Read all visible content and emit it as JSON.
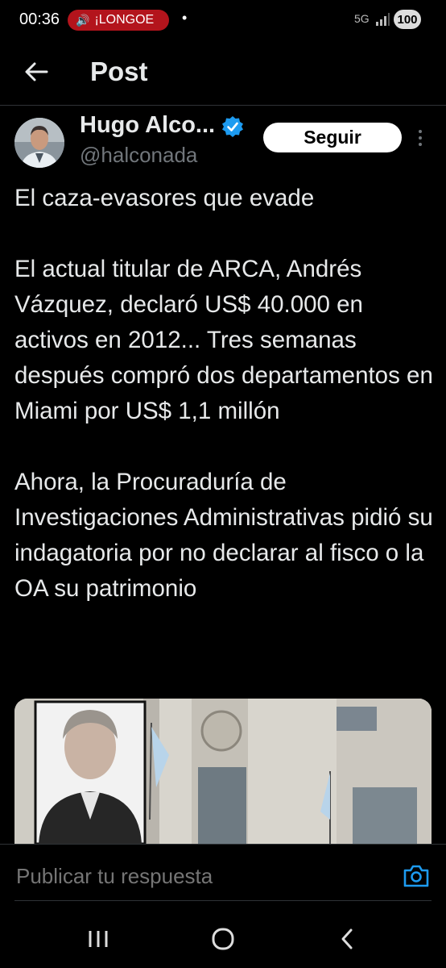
{
  "status_bar": {
    "time": "00:36",
    "notification_pill": "¡LONGOE",
    "network": "5G",
    "battery": "100"
  },
  "header": {
    "title": "Post"
  },
  "post": {
    "author_name": "Hugo Alco...",
    "author_handle": "@halconada",
    "follow_label": "Seguir",
    "paragraphs": [
      "El caza-evasores que evade",
      "El actual titular de ARCA, Andrés Vázquez, declaró US$ 40.000 en activos en 2012... Tres semanas después compró dos departamentos en Miami por US$ 1,1 millón",
      "Ahora, la Procuraduría de Investigaciones Administrativas pidió su indagatoria por no declarar al fisco o la OA su patrimonio"
    ]
  },
  "reply": {
    "placeholder": "Publicar tu respuesta"
  },
  "colors": {
    "background": "#000000",
    "text": "#e7e9ea",
    "muted": "#71767b",
    "accent": "#1d9bf0",
    "pill": "#b3141c"
  },
  "icons": [
    "back-arrow-icon",
    "verified-badge-icon",
    "more-options-icon",
    "camera-icon",
    "recents-icon",
    "home-icon",
    "nav-back-icon"
  ]
}
